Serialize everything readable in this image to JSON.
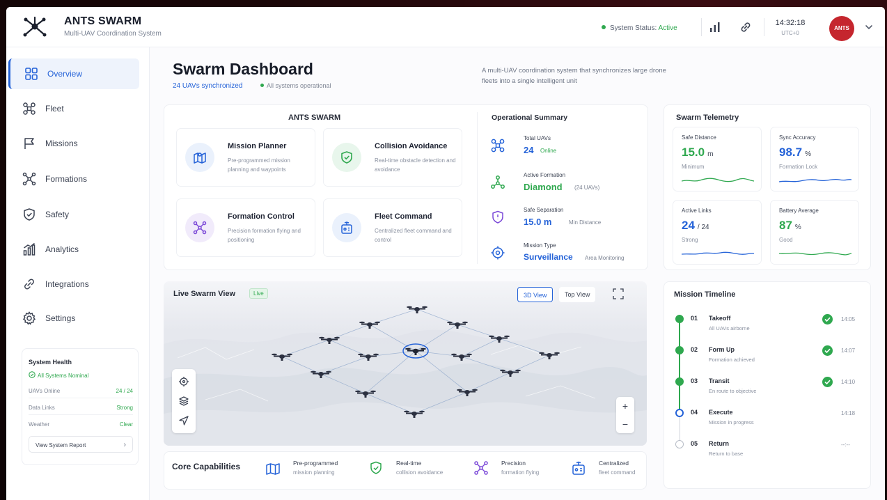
{
  "app": {
    "brand": "ANTS SWARM",
    "tagline": "Multi-UAV Coordination System"
  },
  "topbar": {
    "status_label": "System Status:",
    "status_value": "Active",
    "time": "14:32:18",
    "timezone": "UTC+0",
    "avatar_text": "ANTS"
  },
  "sidebar": {
    "items": [
      {
        "label": "Overview",
        "icon": "grid-icon"
      },
      {
        "label": "Fleet",
        "icon": "drone-icon"
      },
      {
        "label": "Missions",
        "icon": "flag-icon"
      },
      {
        "label": "Formations",
        "icon": "formation-icon"
      },
      {
        "label": "Safety",
        "icon": "shield-icon"
      },
      {
        "label": "Analytics",
        "icon": "chart-icon"
      },
      {
        "label": "Integrations",
        "icon": "link-icon"
      },
      {
        "label": "Settings",
        "icon": "gear-icon"
      }
    ],
    "health": {
      "title": "System Health",
      "status": "All Systems Nominal",
      "rows": [
        {
          "label": "UAVs Online",
          "value": "24 / 24"
        },
        {
          "label": "Data Links",
          "value": "Strong"
        },
        {
          "label": "Weather",
          "value": "Clear"
        }
      ],
      "report_button": "View System Report"
    }
  },
  "header": {
    "title": "Swarm Dashboard",
    "synced": "24 UAVs synchronized",
    "operational": "All systems operational",
    "description": "A multi-UAV coordination system that synchronizes large drone fleets into a single intelligent unit"
  },
  "features": {
    "title": "ANTS SWARM",
    "items": [
      {
        "title": "Mission Planner",
        "desc": "Pre-programmed mission planning and waypoints"
      },
      {
        "title": "Collision Avoidance",
        "desc": "Real-time obstacle detection and avoidance"
      },
      {
        "title": "Formation Control",
        "desc": "Precision formation flying and positioning"
      },
      {
        "title": "Fleet Command",
        "desc": "Centralized fleet command and control"
      }
    ]
  },
  "summary": {
    "title": "Operational Summary",
    "items": [
      {
        "label": "Total UAVs",
        "value": "24",
        "extra": "Online"
      },
      {
        "label": "Active Formation",
        "value": "Diamond",
        "extra": "(24 UAVs)"
      },
      {
        "label": "Safe Separation",
        "value": "15.0 m",
        "extra": "Min Distance"
      },
      {
        "label": "Mission Type",
        "value": "Surveillance",
        "extra": "Area Monitoring"
      }
    ]
  },
  "telemetry": {
    "title": "Swarm Telemetry",
    "items": [
      {
        "label": "Safe Distance",
        "value": "15.0",
        "unit": "m",
        "sub": "Minimum",
        "color": "#2fa84f"
      },
      {
        "label": "Sync Accuracy",
        "value": "98.7",
        "unit": "%",
        "sub": "Formation Lock",
        "color": "#2563d8"
      },
      {
        "label": "Active Links",
        "value": "24",
        "unit": "/ 24",
        "sub": "Strong",
        "color": "#2563d8"
      },
      {
        "label": "Battery Average",
        "value": "87",
        "unit": "%",
        "sub": "Good",
        "color": "#2fa84f"
      }
    ]
  },
  "live_view": {
    "title": "Live Swarm View",
    "badge": "Live",
    "view_3d": "3D View",
    "view_top": "Top View",
    "zoom_in": "+",
    "zoom_out": "−"
  },
  "core": {
    "title": "Core Capabilities",
    "items": [
      {
        "a": "Pre-programmed",
        "b": "mission planning"
      },
      {
        "a": "Real-time",
        "b": "collision avoidance"
      },
      {
        "a": "Precision",
        "b": "formation flying"
      },
      {
        "a": "Centralized",
        "b": "fleet command"
      }
    ]
  },
  "timeline": {
    "title": "Mission Timeline",
    "items": [
      {
        "n": "01",
        "label": "Takeoff",
        "desc": "All UAVs airborne",
        "time": "14:05",
        "state": "done"
      },
      {
        "n": "02",
        "label": "Form Up",
        "desc": "Formation achieved",
        "time": "14:07",
        "state": "done"
      },
      {
        "n": "03",
        "label": "Transit",
        "desc": "En route to objective",
        "time": "14:10",
        "state": "done"
      },
      {
        "n": "04",
        "label": "Execute",
        "desc": "Mission in progress",
        "time": "14:18",
        "state": "current"
      },
      {
        "n": "05",
        "label": "Return",
        "desc": "Return to base",
        "time": "--:--",
        "state": "pending"
      }
    ]
  }
}
